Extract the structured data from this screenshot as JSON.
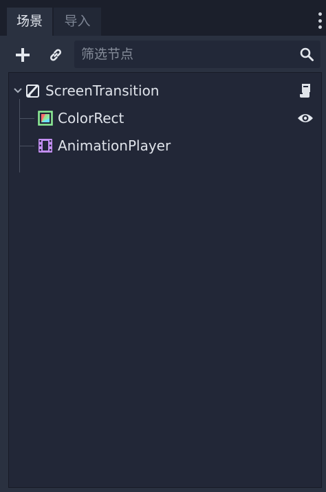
{
  "tabs": [
    {
      "label": "场景",
      "active": true
    },
    {
      "label": "导入",
      "active": false
    }
  ],
  "toolbar": {
    "add_icon": "plus-icon",
    "link_icon": "link-icon",
    "filter_placeholder": "筛选节点",
    "filter_value": "",
    "search_icon": "search-icon"
  },
  "tree": {
    "root": {
      "name": "ScreenTransition",
      "icon": "canvas-layer-icon",
      "expanded": true,
      "action_icon": "script-icon"
    },
    "children": [
      {
        "name": "ColorRect",
        "icon": "color-rect-icon",
        "action_icon": "eye-icon"
      },
      {
        "name": "AnimationPlayer",
        "icon": "animation-player-icon"
      }
    ]
  },
  "colors": {
    "panel": "#2a3140",
    "tree_bg": "#222737",
    "text": "#dfe3ea",
    "accent_green": "#8eef97",
    "accent_purple": "#c38ef1"
  }
}
